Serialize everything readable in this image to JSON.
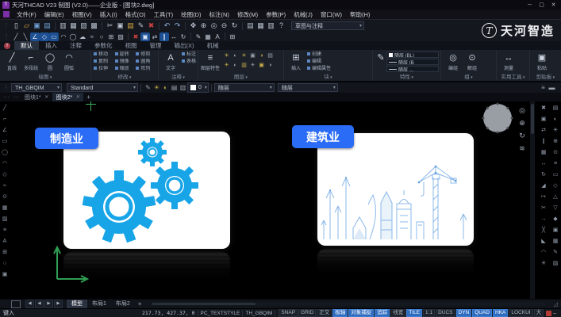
{
  "window": {
    "title": "天河THCAD V23 制图 (V2.0)——企业版 - [图块2.dwg]",
    "app_icon_letter": "T",
    "minimize": "─",
    "maximize": "▢",
    "close": "✕"
  },
  "brand": {
    "name": "天河智造",
    "emblem": "T"
  },
  "menu": {
    "items": [
      "文件(F)",
      "编辑(E)",
      "视图(V)",
      "插入(I)",
      "格式(O)",
      "工具(T)",
      "绘图(D)",
      "标注(N)",
      "修改(M)",
      "参数(P)",
      "机械(J)",
      "窗口(W)",
      "帮助(H)"
    ]
  },
  "toolbar1": {
    "workspace": "草图与注释",
    "icons": [
      {
        "name": "new-icon",
        "glyph": "▯",
        "color": "#cfd6e0"
      },
      {
        "name": "open-icon",
        "glyph": "▱",
        "color": "#d8a944"
      },
      {
        "name": "save-icon",
        "glyph": "▣",
        "color": "#6fa0d8"
      },
      {
        "name": "save-all-icon",
        "glyph": "▤",
        "color": "#6fa0d8"
      },
      {
        "sep": true
      },
      {
        "name": "plot-icon",
        "glyph": "▥"
      },
      {
        "name": "plot-preview-icon",
        "glyph": "▦"
      },
      {
        "name": "publish-icon",
        "glyph": "▧"
      },
      {
        "name": "etransmit-icon",
        "glyph": "▩"
      },
      {
        "sep": true
      },
      {
        "name": "cut-icon",
        "glyph": "✂"
      },
      {
        "name": "copy-clip-icon",
        "glyph": "▣"
      },
      {
        "name": "paste-icon",
        "glyph": "▤",
        "color": "#d8a944"
      },
      {
        "name": "match-properties-icon",
        "glyph": "✎"
      },
      {
        "name": "erase-icon",
        "glyph": "✖",
        "color": "#c9413f"
      },
      {
        "sep": true
      },
      {
        "name": "undo-icon",
        "glyph": "↶",
        "color": "#8fb3e2"
      },
      {
        "name": "redo-icon",
        "glyph": "↷",
        "color": "#8fb3e2"
      },
      {
        "sep": true
      },
      {
        "name": "pan-icon",
        "glyph": "✥"
      },
      {
        "name": "zoom-realtime-icon",
        "glyph": "⊕"
      },
      {
        "name": "zoom-window-icon",
        "glyph": "◎"
      },
      {
        "name": "zoom-previous-icon",
        "glyph": "⊖"
      },
      {
        "name": "orbit-icon",
        "glyph": "↻"
      },
      {
        "sep": true
      },
      {
        "name": "properties-icon",
        "glyph": "▤"
      },
      {
        "name": "designcenter-icon",
        "glyph": "▦"
      },
      {
        "name": "toolpalettes-icon",
        "glyph": "▥"
      },
      {
        "name": "help-icon",
        "glyph": "?"
      }
    ]
  },
  "toolbar2": {
    "icons": [
      {
        "name": "line-icon",
        "glyph": "╱"
      },
      {
        "name": "construction-line-icon",
        "glyph": "╲"
      },
      {
        "name": "polyline-icon",
        "glyph": "∠",
        "bg": "#1d4f93",
        "color": "#dbe6f5"
      },
      {
        "name": "polygon-icon",
        "glyph": "◇",
        "bg": "#1d4f93",
        "color": "#dbe6f5"
      },
      {
        "name": "rectangle-icon",
        "glyph": "▭",
        "bg": "#1d4f93",
        "color": "#dbe6f5"
      },
      {
        "name": "arc-icon",
        "glyph": "◠"
      },
      {
        "name": "circle-icon",
        "glyph": "◯"
      },
      {
        "name": "revcloud-icon",
        "glyph": "☁"
      },
      {
        "name": "spline-icon",
        "glyph": "≈"
      },
      {
        "name": "ellipse-icon",
        "glyph": "○"
      },
      {
        "name": "insert-block-icon",
        "glyph": "⊞"
      },
      {
        "name": "hatch-icon",
        "glyph": "▨"
      },
      {
        "sep": true
      },
      {
        "name": "erase2-icon",
        "glyph": "✖",
        "color": "#c9413f"
      },
      {
        "name": "copy-icon",
        "glyph": "▣",
        "bg": "#1d4f93",
        "color": "#dbe6f5"
      },
      {
        "name": "mirror-icon",
        "glyph": "⇄"
      },
      {
        "name": "offset-icon",
        "glyph": "∥",
        "bg": "#1d4f93",
        "color": "#dbe6f5"
      },
      {
        "name": "move-icon",
        "glyph": "↔"
      },
      {
        "name": "rotate-icon",
        "glyph": "↻"
      },
      {
        "sep": true
      },
      {
        "name": "matchprop-icon",
        "glyph": "✎"
      },
      {
        "name": "table-icon",
        "glyph": "▦"
      },
      {
        "name": "text-icon",
        "glyph": "A"
      },
      {
        "sep": true
      },
      {
        "name": "grid-view-icon",
        "glyph": "⊞"
      }
    ]
  },
  "ribbon": {
    "tabs": [
      {
        "label": "默认",
        "active": true
      },
      {
        "label": "插入"
      },
      {
        "label": "注释"
      },
      {
        "label": "参数化"
      },
      {
        "label": "视图"
      },
      {
        "label": "管理"
      },
      {
        "label": "输出(X)"
      },
      {
        "label": "机械"
      }
    ],
    "panels": {
      "draw": {
        "caption": "绘图",
        "items": [
          {
            "label": "直线",
            "glyph": "╱"
          },
          {
            "label": "多段线",
            "glyph": "⌐"
          },
          {
            "label": "圆",
            "glyph": "◯"
          },
          {
            "label": "圆弧",
            "glyph": "◠"
          }
        ]
      },
      "modify": {
        "caption": "修改",
        "grid": [
          "移动",
          "旋转",
          "修剪",
          "复制",
          "镜像",
          "圆角",
          "拉伸",
          "缩放",
          "阵列"
        ]
      },
      "annotate": {
        "caption": "注释",
        "big_glyph": "A",
        "big_label": "文字",
        "items": [
          "标注",
          "表格"
        ]
      },
      "layers": {
        "caption": "图层",
        "big_glyph": "≡",
        "big_label": "图层特性",
        "bulbs": [
          "☀",
          "◐",
          "☀",
          "▣",
          "◑",
          "▤",
          "☀",
          "◐",
          "▥",
          "☀",
          "▣",
          "◑"
        ]
      },
      "block": {
        "caption": "块",
        "big_glyph": "⊞",
        "big_label": "插入",
        "items": [
          "创建",
          "编辑",
          "编辑属性"
        ]
      },
      "properties": {
        "caption": "特性",
        "big_glyph": "✎",
        "rows": [
          "随层 (BL)",
          "随层 (B",
          "随层 ..."
        ]
      },
      "groups": {
        "caption": "组",
        "items": [
          {
            "label": "编组",
            "glyph": "◎"
          },
          {
            "label": "解组",
            "glyph": "⊙"
          }
        ]
      },
      "utilities": {
        "caption": "实用工具",
        "big_glyph": "↔",
        "big_label": "测量"
      },
      "clipboard": {
        "caption": "剪贴板",
        "big_glyph": "▣",
        "big_label": "粘贴"
      }
    }
  },
  "quickbar": {
    "combo1": "TH_GBQIM",
    "combo2": "Standard",
    "icons": [
      {
        "name": "layer-states-icon",
        "glyph": "✎"
      },
      {
        "name": "layer-on-icon",
        "glyph": "☀",
        "color": "#c9b04a"
      },
      {
        "name": "layer-freeze-icon",
        "glyph": "◐",
        "color": "#c9b04a"
      },
      {
        "name": "layer-lock-icon",
        "glyph": "▤"
      },
      {
        "name": "layer-plot-icon",
        "glyph": "▥"
      }
    ],
    "layer_value": "0",
    "bylayer_color": "随层",
    "bylayer_line": "随层",
    "right_icons": [
      {
        "name": "linetype-icon",
        "glyph": "≡"
      },
      {
        "name": "lineweight-icon",
        "glyph": "▬"
      }
    ]
  },
  "file_tabs": {
    "tabs": [
      {
        "label": "图块1*"
      },
      {
        "label": "图块2*",
        "active": true
      }
    ],
    "add": "+"
  },
  "canvas": {
    "left_icons": [
      {
        "name": "line-icon",
        "glyph": "╱"
      },
      {
        "name": "polyline-icon",
        "glyph": "⌐"
      },
      {
        "name": "angle-icon",
        "glyph": "∠"
      },
      {
        "name": "rectangle-icon",
        "glyph": "▭"
      },
      {
        "name": "circle-icon",
        "glyph": "◯"
      },
      {
        "name": "arc-icon",
        "glyph": "◠"
      },
      {
        "name": "polygon-icon",
        "glyph": "◇"
      },
      {
        "name": "spline-icon",
        "glyph": "≈"
      },
      {
        "name": "point-icon",
        "glyph": "⊙"
      },
      {
        "name": "table-icon",
        "glyph": "▦"
      },
      {
        "name": "hatch-icon",
        "glyph": "▨"
      },
      {
        "name": "region-icon",
        "glyph": "≡"
      },
      {
        "name": "text-icon",
        "glyph": "A"
      },
      {
        "name": "insert-icon",
        "glyph": "⊞"
      },
      {
        "name": "ellipse-icon",
        "glyph": "○"
      },
      {
        "name": "block-icon",
        "glyph": "▣"
      }
    ],
    "nav_icons": [
      {
        "name": "full-nav-wheel-icon",
        "glyph": "◎"
      },
      {
        "name": "zoom-icon",
        "glyph": "⊕"
      },
      {
        "name": "orbit-icon",
        "glyph": "↻"
      },
      {
        "name": "layers-stack-icon",
        "glyph": "≋"
      }
    ],
    "right_icons_a": [
      {
        "name": "erase-icon",
        "glyph": "✖"
      },
      {
        "name": "copy-icon",
        "glyph": "▣"
      },
      {
        "name": "mirror-icon",
        "glyph": "⇄"
      },
      {
        "name": "offset-icon",
        "glyph": "∥"
      },
      {
        "name": "array-icon",
        "glyph": "▦"
      },
      {
        "name": "move-icon",
        "glyph": "↔"
      },
      {
        "name": "rotate-icon",
        "glyph": "↻"
      },
      {
        "name": "scale-icon",
        "glyph": "◢"
      },
      {
        "name": "stretch-icon",
        "glyph": "↦"
      },
      {
        "name": "trim-icon",
        "glyph": "✂"
      },
      {
        "name": "extend-icon",
        "glyph": "→"
      },
      {
        "name": "break-icon",
        "glyph": "╳"
      },
      {
        "name": "chamfer-icon",
        "glyph": "◣"
      },
      {
        "name": "fillet-icon",
        "glyph": "◠"
      },
      {
        "name": "explode-icon",
        "glyph": "✳"
      }
    ],
    "right_icons_b": [
      {
        "name": "layer-properties-icon",
        "glyph": "▤"
      },
      {
        "name": "layer-freeze-icon",
        "glyph": "◐"
      },
      {
        "name": "layer-on-icon",
        "glyph": "☀"
      },
      {
        "name": "zoom-extents-icon",
        "glyph": "⊕"
      },
      {
        "name": "point-style-icon",
        "glyph": "⊙"
      },
      {
        "name": "draworder-icon",
        "glyph": "≡"
      },
      {
        "name": "viewport-icon",
        "glyph": "▭"
      },
      {
        "name": "osnap-icon",
        "glyph": "◇"
      },
      {
        "name": "up-icon",
        "glyph": "△"
      },
      {
        "name": "down-icon",
        "glyph": "▽"
      },
      {
        "name": "solid-icon",
        "glyph": "◆"
      },
      {
        "name": "copy-props-icon",
        "glyph": "▣"
      },
      {
        "name": "grid-icon",
        "glyph": "▦"
      },
      {
        "name": "edit-icon",
        "glyph": "✎"
      },
      {
        "name": "hatch-edit-icon",
        "glyph": "▨"
      }
    ],
    "cards": [
      {
        "label": "制造业"
      },
      {
        "label": "建筑业"
      }
    ],
    "colors": {
      "card_label_bg": "#2a6cf5",
      "gear_blue": "#17a5e8",
      "line_art_blue": "#8ab8e8"
    }
  },
  "layout_bar": {
    "nav": [
      {
        "name": "first-layout-icon",
        "glyph": "◀"
      },
      {
        "name": "prev-layout-icon",
        "glyph": "◀"
      },
      {
        "name": "next-layout-icon",
        "glyph": "▶"
      },
      {
        "name": "last-layout-icon",
        "glyph": "▶"
      }
    ],
    "tabs": [
      {
        "label": "模型",
        "active": true
      },
      {
        "label": "布局1"
      },
      {
        "label": "布局2"
      }
    ],
    "add": "+"
  },
  "status_bar": {
    "prompt": "键入",
    "coords": "217.73, 427.37, 0",
    "text_style": "PC_TEXTSTYLE",
    "dim_style": "TH_GBQIM",
    "toggles": [
      {
        "label": "SNAP"
      },
      {
        "label": "GRID"
      },
      {
        "label": "正交"
      },
      {
        "label": "极轴",
        "active": true
      },
      {
        "label": "对象捕捉",
        "active": true
      },
      {
        "label": "追踪",
        "active": true
      },
      {
        "label": "线宽"
      },
      {
        "label": "TILE",
        "active": true
      },
      {
        "label": "1:1"
      },
      {
        "label": "DUCS"
      },
      {
        "label": "DYN",
        "active": true
      },
      {
        "label": "QUAD",
        "active": true
      },
      {
        "label": "HKA",
        "active": true
      },
      {
        "label": "LOCKUI"
      },
      {
        "label": "大"
      }
    ]
  }
}
